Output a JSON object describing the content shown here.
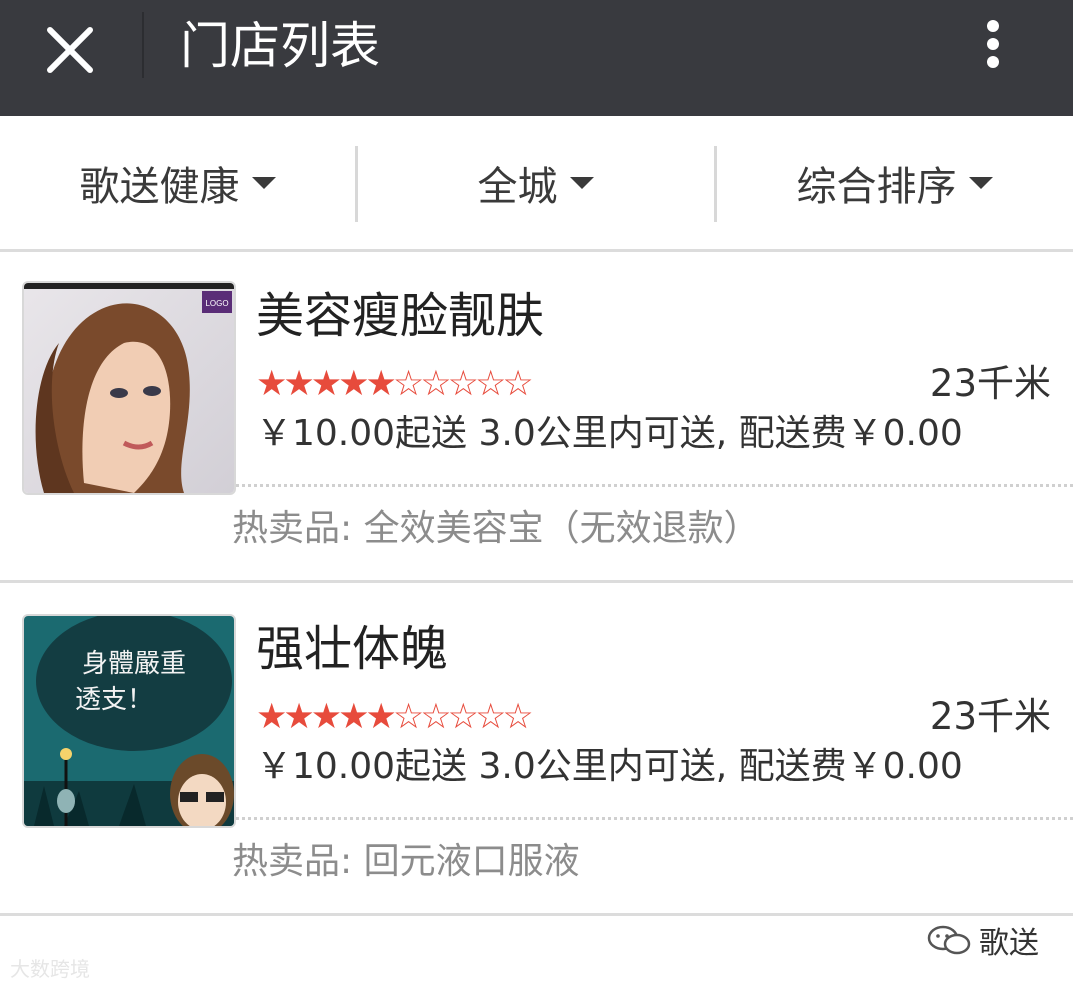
{
  "app": {
    "title": "门店列表"
  },
  "filters": [
    {
      "label": "歌送健康"
    },
    {
      "label": "全城"
    },
    {
      "label": "综合排序"
    }
  ],
  "stores": [
    {
      "name": "美容瘦脸靓肤",
      "rating": 5,
      "rating_max": 10,
      "stars_filled": "★★★★★",
      "stars_empty": "☆☆☆☆☆",
      "distance": "23千米",
      "delivery": "￥10.00起送 3.0公里内可送, 配送费￥0.00",
      "hot_item": "热卖品: 全效美容宝（无效退款）",
      "thumb_logo": "LOGO"
    },
    {
      "name": "强壮体魄",
      "rating": 5,
      "rating_max": 10,
      "stars_filled": "★★★★★",
      "stars_empty": "☆☆☆☆☆",
      "distance": "23千米",
      "delivery": "￥10.00起送 3.0公里内可送, 配送费￥0.00",
      "hot_item": "热卖品: 回元液口服液",
      "thumb_text_1": "身體嚴重",
      "thumb_text_2": "透支！"
    }
  ],
  "watermark": {
    "left": "大数跨境",
    "right": "歌送"
  },
  "colors": {
    "topbar": "#393a3f",
    "star": "#e74b3c",
    "muted": "#8c8c8c"
  }
}
